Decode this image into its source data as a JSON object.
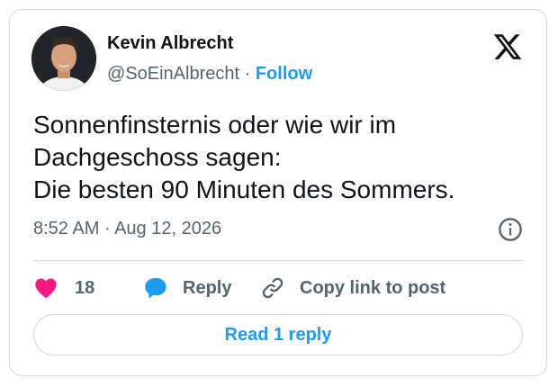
{
  "author": {
    "name": "Kevin Albrecht",
    "handle": "@SoEinAlbrecht",
    "separator": "·",
    "follow_label": "Follow"
  },
  "post": {
    "lines": [
      "Sonnenfinsternis oder wie wir im",
      "Dachgeschoss sagen:",
      "Die besten 90 Minuten des Sommers."
    ],
    "time": "8:52 AM",
    "separator": "·",
    "date": "Aug 12, 2026"
  },
  "actions": {
    "like_count": "18",
    "reply_label": "Reply",
    "copy_label": "Copy link to post"
  },
  "read_replies_label": "Read 1 reply",
  "icons": {
    "brand": "x-logo-icon",
    "info": "info-icon",
    "like": "heart-icon",
    "reply": "speech-bubble-icon",
    "copy": "link-icon"
  },
  "colors": {
    "like": "#f91880",
    "accent": "#1d9bf0",
    "muted": "#536471",
    "text": "#0f1419",
    "border": "#cfd9de"
  }
}
